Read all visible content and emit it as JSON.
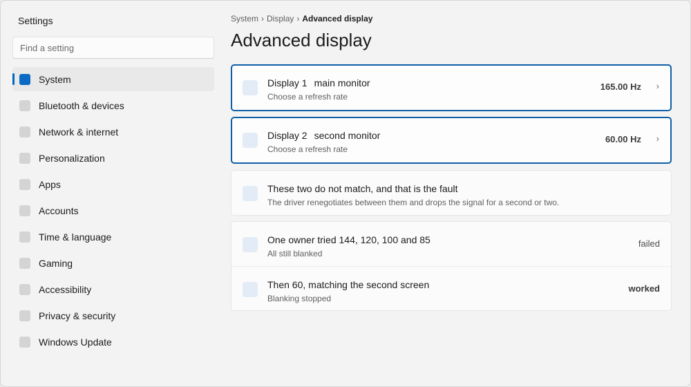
{
  "app": {
    "title": "Settings"
  },
  "search": {
    "placeholder": "Find a setting"
  },
  "sidebar": {
    "items": [
      {
        "label": "System",
        "active": true
      },
      {
        "label": "Bluetooth & devices"
      },
      {
        "label": "Network & internet"
      },
      {
        "label": "Personalization"
      },
      {
        "label": "Apps"
      },
      {
        "label": "Accounts"
      },
      {
        "label": "Time & language"
      },
      {
        "label": "Gaming"
      },
      {
        "label": "Accessibility"
      },
      {
        "label": "Privacy & security"
      },
      {
        "label": "Windows Update"
      }
    ]
  },
  "breadcrumb": {
    "items": [
      "System",
      "Display",
      "Advanced display"
    ],
    "separator": "›"
  },
  "page": {
    "title": "Advanced display"
  },
  "displays": [
    {
      "name": "Display 1",
      "tag": "main monitor",
      "subtitle": "Choose a refresh rate",
      "value": "165.00 Hz",
      "chevron": "›"
    },
    {
      "name": "Display 2",
      "tag": "second monitor",
      "subtitle": "Choose a refresh rate",
      "value": "60.00 Hz",
      "chevron": "›"
    }
  ],
  "note": {
    "title": "These two do not match, and that is the fault",
    "subtitle": "The driver renegotiates between them and drops the signal for a second or two."
  },
  "attempts": [
    {
      "title": "One owner tried 144, 120, 100 and 85",
      "subtitle": "All still blanked",
      "status": "failed"
    },
    {
      "title": "Then 60, matching the second screen",
      "subtitle": "Blanking stopped",
      "status": "worked"
    }
  ],
  "colors": {
    "accent": "#0067c0",
    "selected_border": "#0e5fa8",
    "background": "#f3f3f3",
    "card": "#fbfbfb"
  }
}
